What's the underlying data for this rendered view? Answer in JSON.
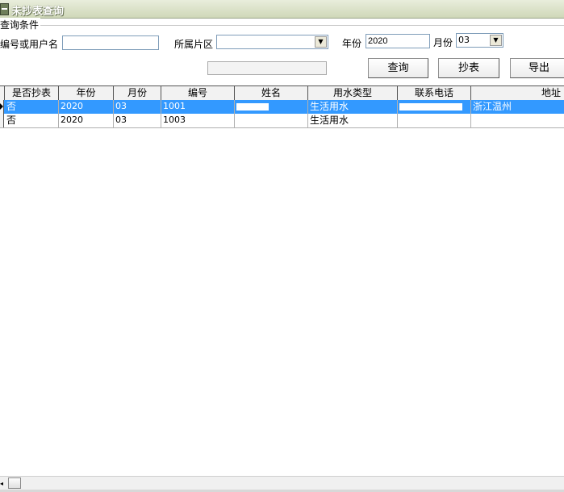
{
  "window": {
    "title": "未抄表查询"
  },
  "query_group": {
    "title": "查询条件",
    "id_or_name_label": "编号或用户名",
    "id_or_name_value": "",
    "area_label": "所属片区",
    "area_value": "",
    "year_label": "年份",
    "year_value": "2020",
    "month_label": "月份",
    "month_value": "03"
  },
  "buttons": {
    "query": "查询",
    "read_meter": "抄表",
    "export": "导出"
  },
  "table": {
    "columns": [
      "是否抄表",
      "年份",
      "月份",
      "编号",
      "姓名",
      "用水类型",
      "联系电话",
      "地址"
    ],
    "rows": [
      {
        "read": "否",
        "year": "2020",
        "month": "03",
        "id": "1001",
        "name": "",
        "water_type": "生活用水",
        "phone": "",
        "address": "浙江温州",
        "selected": true
      },
      {
        "read": "否",
        "year": "2020",
        "month": "03",
        "id": "1003",
        "name": "",
        "water_type": "生活用水",
        "phone": "",
        "address": "",
        "selected": false
      }
    ]
  },
  "colors": {
    "selection": "#3399ff",
    "title_gradient_start": "#e9eedc",
    "title_gradient_end": "#cfd8b8"
  },
  "icons": {
    "window_icon": "window-menu-icon",
    "dropdown": "chevron-down-icon",
    "row_indicator": "current-row-arrow-icon"
  }
}
